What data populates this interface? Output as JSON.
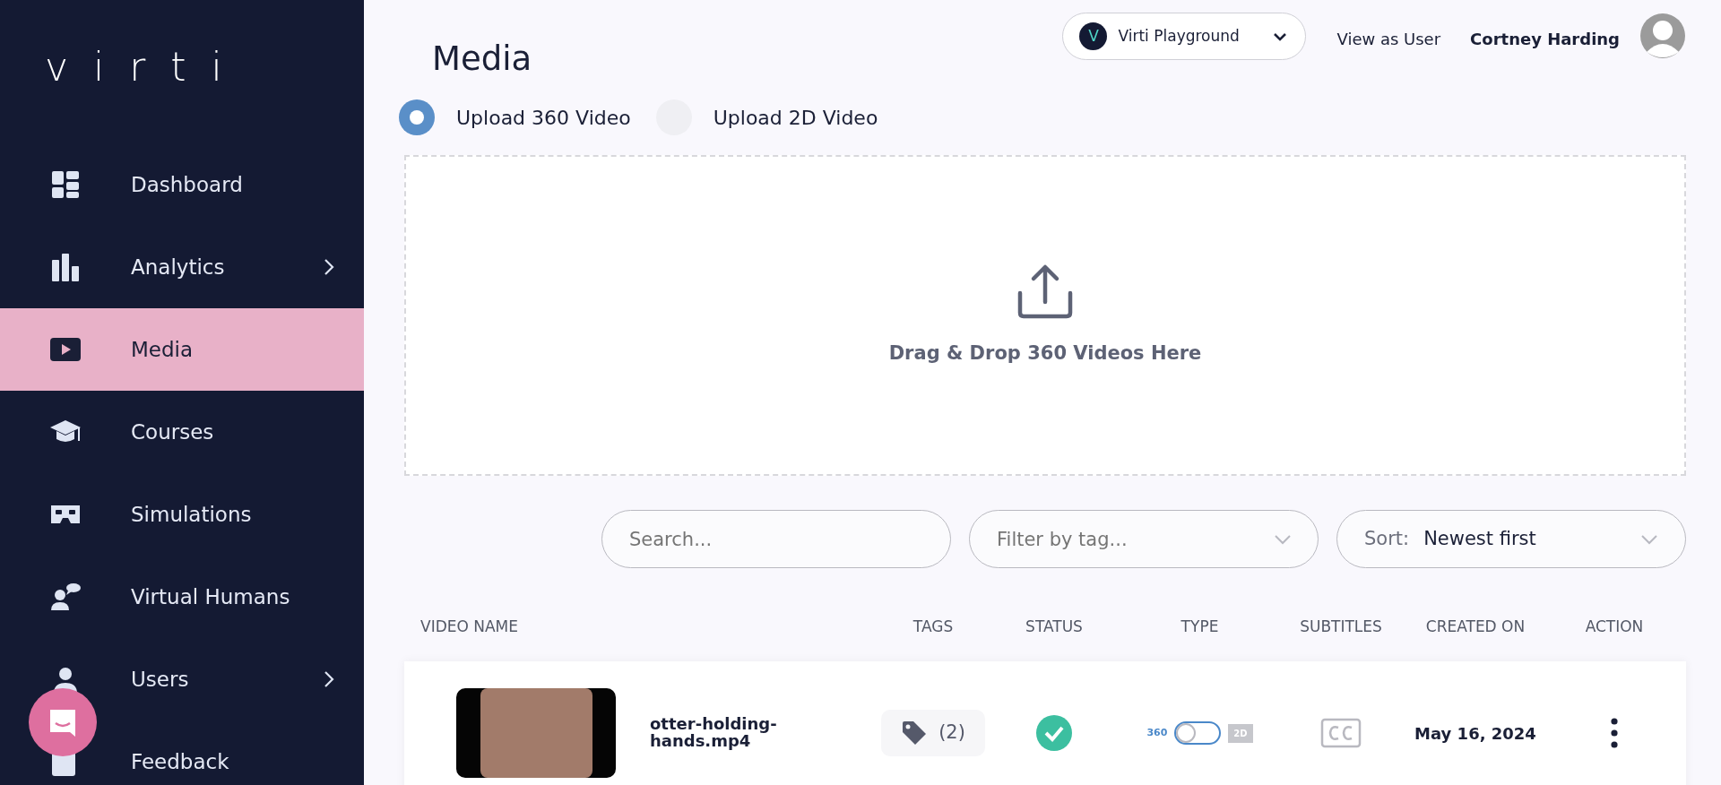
{
  "sidebar": {
    "logo": "virti",
    "items": [
      {
        "label": "Dashboard",
        "selected": false,
        "submenu": false
      },
      {
        "label": "Analytics",
        "selected": false,
        "submenu": true
      },
      {
        "label": "Media",
        "selected": true,
        "submenu": false
      },
      {
        "label": "Courses",
        "selected": false,
        "submenu": false
      },
      {
        "label": "Simulations",
        "selected": false,
        "submenu": false
      },
      {
        "label": "Virtual Humans",
        "selected": false,
        "submenu": false
      },
      {
        "label": "Users",
        "selected": false,
        "submenu": true
      },
      {
        "label": "Feedback",
        "selected": false,
        "submenu": false
      }
    ]
  },
  "header": {
    "title": "Media",
    "org": {
      "badge": "V",
      "name": "Virti Playground"
    },
    "view_as": "View as User",
    "user": "Cortney Harding"
  },
  "upload_modes": [
    {
      "label": "Upload 360 Video",
      "selected": true
    },
    {
      "label": "Upload 2D Video",
      "selected": false
    }
  ],
  "dropzone": {
    "text": "Drag & Drop 360 Videos Here"
  },
  "filters": {
    "search": {
      "placeholder": "Search..."
    },
    "tag": {
      "placeholder": "Filter by tag..."
    },
    "sort": {
      "label": "Sort:",
      "value": "Newest first"
    }
  },
  "table": {
    "columns": [
      "VIDEO NAME",
      "TAGS",
      "STATUS",
      "TYPE",
      "SUBTITLES",
      "CREATED ON",
      "ACTION"
    ],
    "rows": [
      {
        "name": "otter-holding-hands.mp4",
        "tags": "(2)",
        "ready": true,
        "type_labels": [
          "360",
          "2D"
        ],
        "is_2d": false,
        "created": "May 16, 2024"
      }
    ]
  }
}
